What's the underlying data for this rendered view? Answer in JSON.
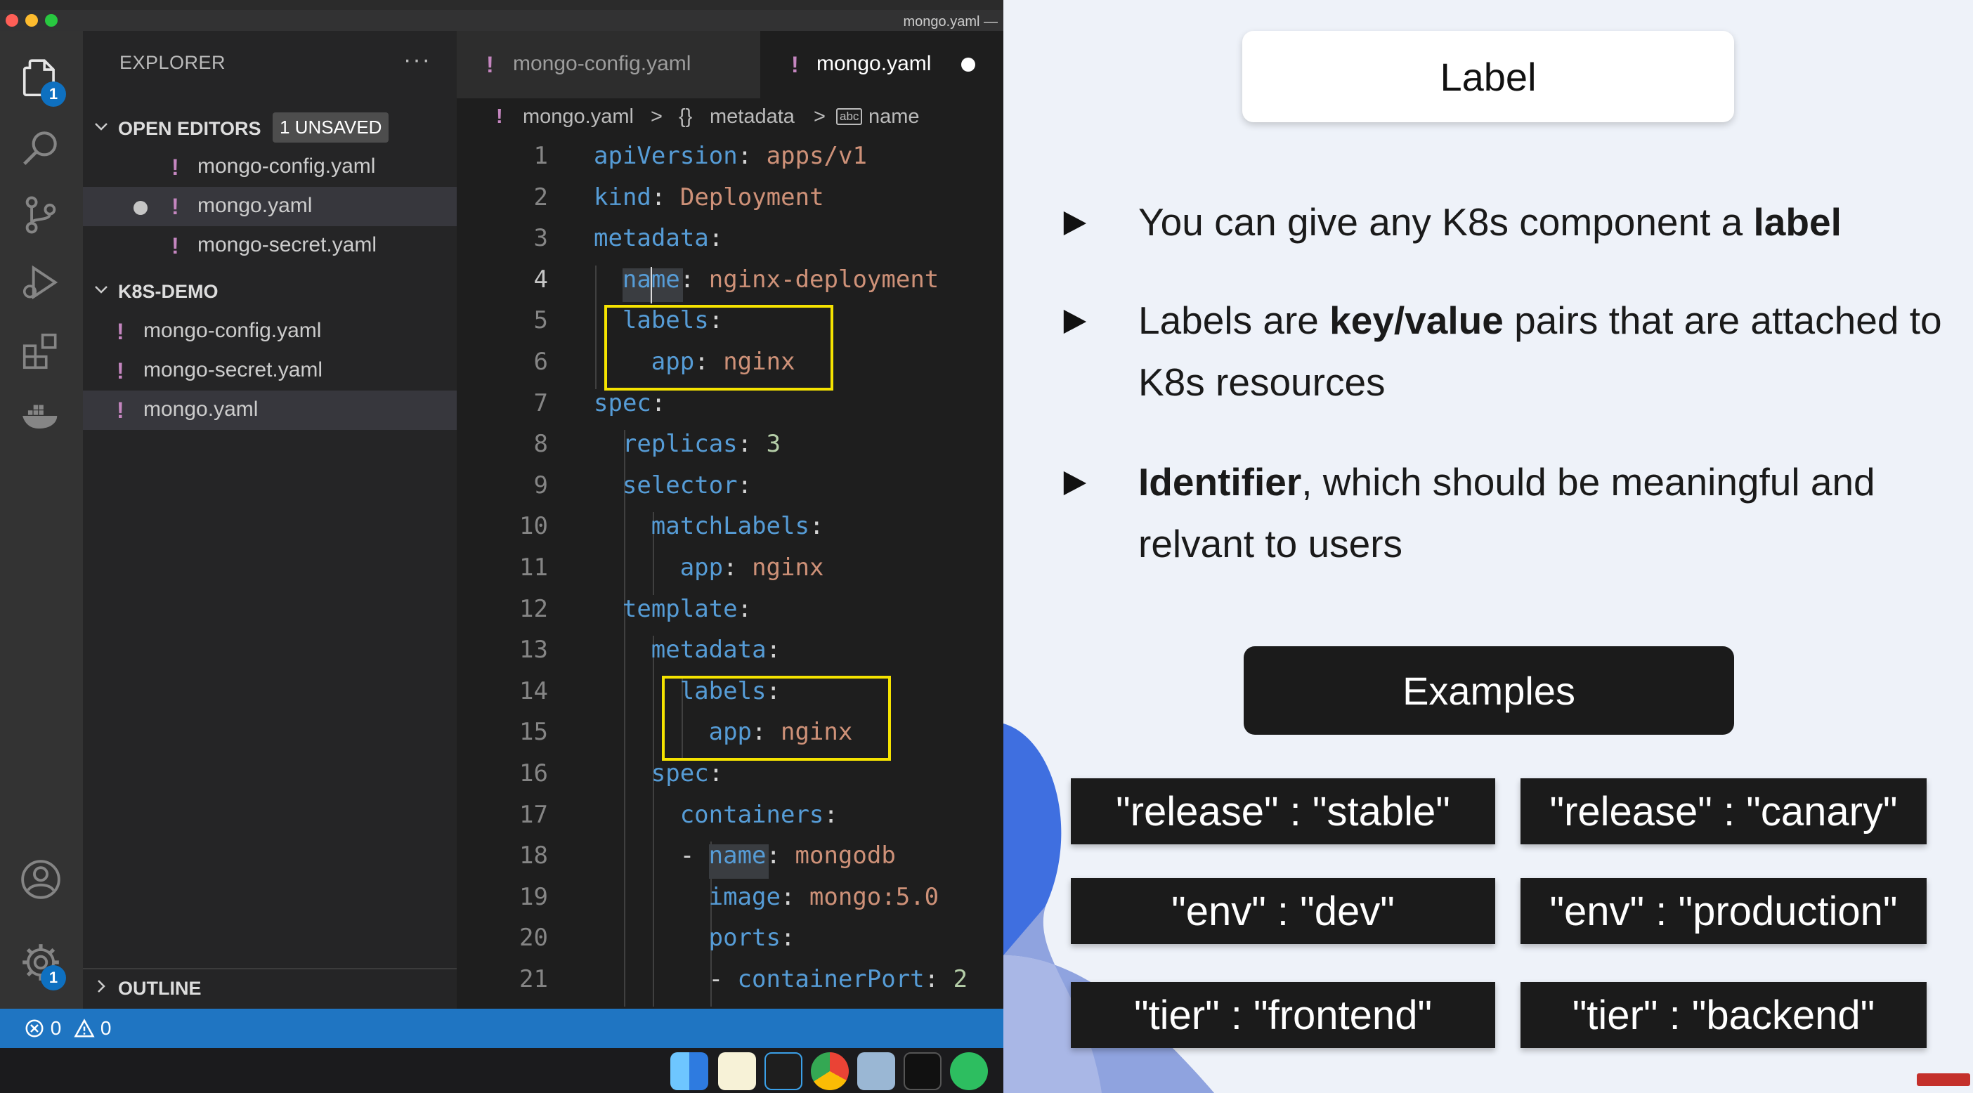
{
  "window": {
    "title": "mongo.yaml —"
  },
  "colors": {
    "accent_blue": "#0e70c0",
    "statusbar": "#1f75c2",
    "highlight_box": "#f5e300",
    "yaml_key": "#569cd6",
    "yaml_value": "#ce9178",
    "yaml_number": "#b5cea8"
  },
  "activity_bar": {
    "items": [
      {
        "icon": "files-icon",
        "badge": "1"
      },
      {
        "icon": "search-icon"
      },
      {
        "icon": "source-control-icon"
      },
      {
        "icon": "run-debug-icon"
      },
      {
        "icon": "extensions-icon"
      },
      {
        "icon": "docker-icon"
      },
      {
        "icon": "accounts-icon"
      },
      {
        "icon": "gear-icon",
        "badge": "1"
      }
    ]
  },
  "sidebar": {
    "header": "EXPLORER",
    "more": "···",
    "open_editors": {
      "title": "OPEN EDITORS",
      "badge": "1 UNSAVED",
      "files": [
        "mongo-config.yaml",
        "mongo.yaml",
        "mongo-secret.yaml"
      ]
    },
    "project": {
      "title": "K8S-DEMO",
      "files": [
        "mongo-config.yaml",
        "mongo-secret.yaml",
        "mongo.yaml"
      ]
    },
    "outline": "OUTLINE"
  },
  "editor": {
    "tabs": [
      "mongo-config.yaml",
      "mongo.yaml"
    ],
    "tab_bang": "!",
    "breadcrumb": {
      "file": "mongo.yaml",
      "sep": ">",
      "obj_icon": "{}",
      "obj": "metadata",
      "str_icon": "abc",
      "key": "name"
    },
    "line_numbers": [
      "1",
      "2",
      "3",
      "4",
      "5",
      "6",
      "7",
      "8",
      "9",
      "10",
      "11",
      "12",
      "13",
      "14",
      "15",
      "16",
      "17",
      "18",
      "19",
      "20",
      "21"
    ],
    "code": [
      {
        "key": "apiVersion",
        "value": "apps/v1"
      },
      {
        "key": "kind",
        "value": "Deployment"
      },
      {
        "key": "metadata",
        "value": ""
      },
      {
        "key": "name",
        "value": "nginx-deployment"
      },
      {
        "key": "labels",
        "value": ""
      },
      {
        "key": "app",
        "value": "nginx"
      },
      {
        "key": "spec",
        "value": ""
      },
      {
        "key": "replicas",
        "value": "3"
      },
      {
        "key": "selector",
        "value": ""
      },
      {
        "key": "matchLabels",
        "value": ""
      },
      {
        "key": "app",
        "value": "nginx"
      },
      {
        "key": "template",
        "value": ""
      },
      {
        "key": "metadata",
        "value": ""
      },
      {
        "key": "labels",
        "value": ""
      },
      {
        "key": "app",
        "value": "nginx"
      },
      {
        "key": "spec",
        "value": ""
      },
      {
        "key": "containers",
        "value": ""
      },
      {
        "key": "name",
        "value": "mongodb",
        "prefix": "- "
      },
      {
        "key": "image",
        "value": "mongo:5.0"
      },
      {
        "key": "ports",
        "value": ""
      },
      {
        "key": "containerPort",
        "value": "2",
        "prefix": "- "
      }
    ]
  },
  "statusbar": {
    "errors": "0",
    "warnings": "0"
  },
  "dock": {
    "apps": [
      "finder-icon",
      "notes-icon",
      "vscode-icon",
      "chrome-icon",
      "preview-icon",
      "terminal-icon",
      "evernote-icon"
    ]
  },
  "slide": {
    "title": "Label",
    "bullets": [
      {
        "parts": [
          {
            "t": "You can give any K8s component a "
          },
          {
            "t": "label",
            "b": true
          }
        ]
      },
      {
        "parts": [
          {
            "t": "Labels are "
          },
          {
            "t": "key/value",
            "b": true
          },
          {
            "t": " pairs that are attached to K8s resources"
          }
        ]
      },
      {
        "parts": [
          {
            "t": "Identifier",
            "b": true
          },
          {
            "t": ", which should be meaningful and relvant to users"
          }
        ]
      }
    ],
    "examples_title": "Examples",
    "examples": [
      "\"release\" : \"stable\"",
      "\"release\" : \"canary\"",
      "\"env\" : \"dev\"",
      "\"env\" : \"production\"",
      "\"tier\" : \"frontend\"",
      "\"tier\" : \"backend\""
    ]
  }
}
